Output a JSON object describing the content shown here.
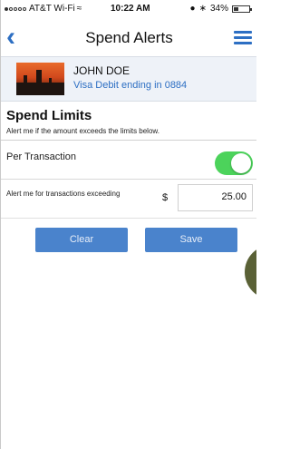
{
  "status_bar": {
    "carrier": "AT&T Wi-Fi",
    "time": "10:22 AM",
    "battery": "34%",
    "battery_level": 0.34
  },
  "header": {
    "title": "Spend Alerts",
    "back_icon": "chevron-left-icon",
    "menu_icon": "hamburger-menu-icon"
  },
  "account": {
    "name": "JOHN DOE",
    "description": "Visa Debit ending in 0884"
  },
  "spend_limits": {
    "heading": "Spend Limits",
    "subtitle": "Alert me if the amount exceeds the limits below.",
    "per_transaction_label": "Per Transaction",
    "per_transaction_enabled": true,
    "alert_label": "Alert me for transactions exceeding",
    "currency_symbol": "$",
    "amount": "25.00"
  },
  "actions": {
    "clear_label": "Clear",
    "save_label": "Save"
  },
  "colors": {
    "accent": "#2d6fc3",
    "button": "#4a83cc",
    "toggle_on": "#4cd35b",
    "card_bg": "#eef2f8"
  }
}
